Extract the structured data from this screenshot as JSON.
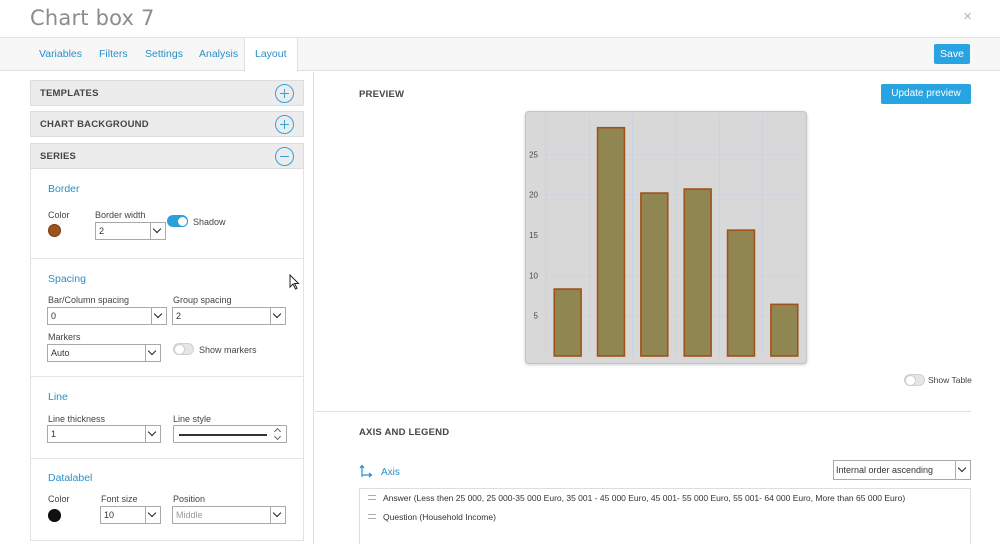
{
  "window": {
    "title": "Chart box 7",
    "close_label": "×"
  },
  "tabs": [
    {
      "label": "Variables"
    },
    {
      "label": "Filters"
    },
    {
      "label": "Settings"
    },
    {
      "label": "Analysis"
    },
    {
      "label": "Layout",
      "active": true
    }
  ],
  "toolbar": {
    "save_label": "Save"
  },
  "left": {
    "accordions": {
      "templates": "TEMPLATES",
      "chart_background": "CHART BACKGROUND",
      "series": "SERIES"
    },
    "border": {
      "title": "Border",
      "color_label": "Color",
      "color_value": "#a0521b",
      "width_label": "Border width",
      "width_value": "2",
      "shadow_label": "Shadow",
      "shadow_on": true
    },
    "spacing": {
      "title": "Spacing",
      "bar_label": "Bar/Column spacing",
      "bar_value": "0",
      "group_label": "Group spacing",
      "group_value": "2",
      "markers_label": "Markers",
      "markers_value": "Auto",
      "show_markers_label": "Show markers",
      "show_markers_on": false
    },
    "line": {
      "title": "Line",
      "thickness_label": "Line thickness",
      "thickness_value": "1",
      "style_label": "Line style"
    },
    "datalabel": {
      "title": "Datalabel",
      "color_label": "Color",
      "color_value": "#111111",
      "font_size_label": "Font size",
      "font_size_value": "10",
      "position_label": "Position",
      "position_value": "Middle"
    }
  },
  "right": {
    "preview_heading": "PREVIEW",
    "update_label": "Update preview",
    "show_table_label": "Show Table",
    "show_table_on": false,
    "axis_heading": "AXIS AND LEGEND",
    "axis_label": "Axis",
    "order_value": "Internal order ascending",
    "axis_items": [
      "Answer (Less then 25 000, 25 000-35 000 Euro, 35 001 - 45 000 Euro, 45 001- 55 000 Euro, 55 001- 64 000 Euro, More than 65 000 Euro)",
      "Question (Household Income)"
    ]
  },
  "colors": {
    "accent": "#27a4e1",
    "bar_fill": "#8f8652",
    "bar_border": "#a0521b",
    "chart_bg": "#d8d8d8"
  },
  "chart_data": {
    "type": "bar",
    "categories": [
      "",
      "",
      "",
      "",
      "",
      ""
    ],
    "values": [
      8.3,
      28.3,
      20.2,
      20.7,
      15.6,
      6.4
    ],
    "yticks": [
      5,
      10,
      15,
      20,
      25
    ],
    "ylim": [
      0,
      30
    ],
    "grid": true,
    "legend": "none"
  }
}
